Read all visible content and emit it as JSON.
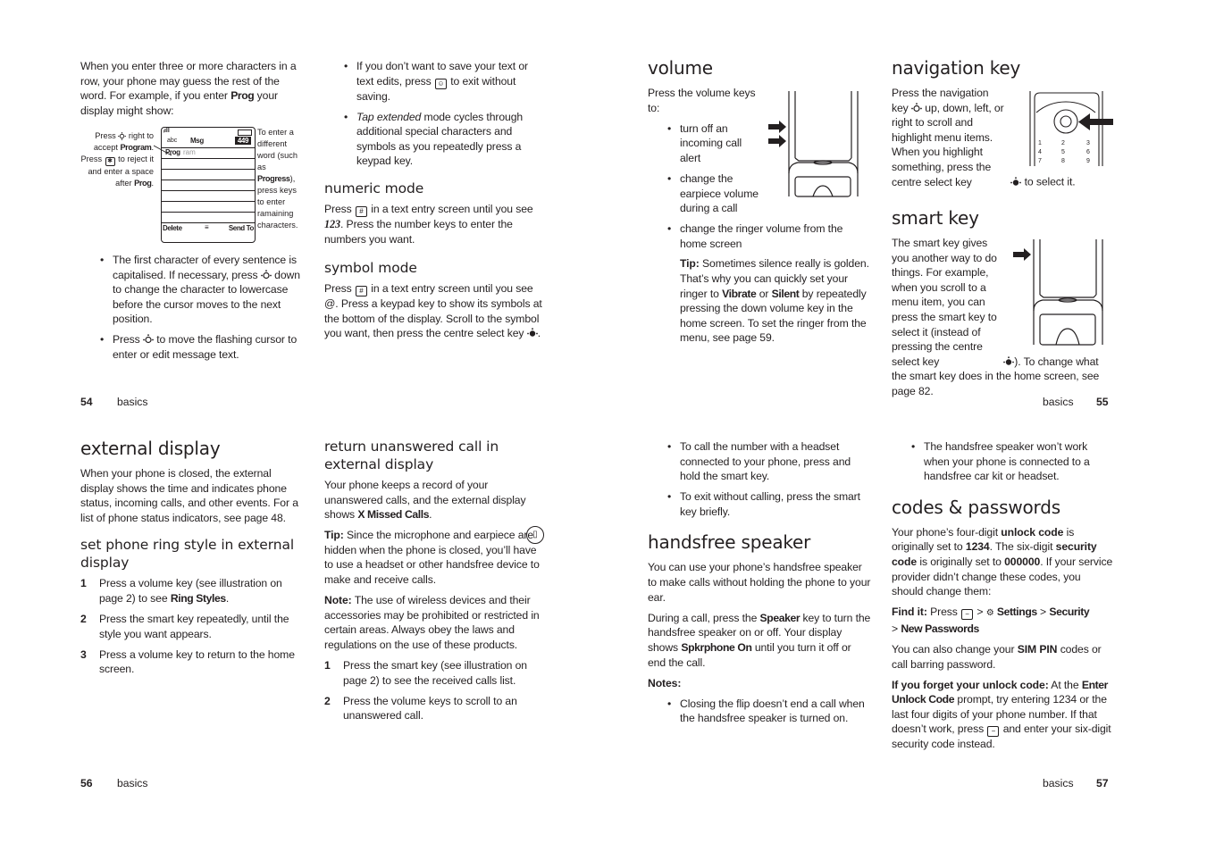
{
  "page54": {
    "intro": "When you enter three or more characters in a row, your phone may guess the rest of the word. For example, if you enter",
    "intro_bold": "Prog",
    "intro_end": "your display might show:",
    "figure": {
      "left_note_1": "Press",
      "left_note_2": "right to accept",
      "left_note_bold": "Program",
      "left_note_3": "Press",
      "left_note_4": "to reject it and enter a space after",
      "left_note_bold2": "Prog",
      "right_note_1": "To enter a different word (such as",
      "right_note_bold": "Progress",
      "right_note_2": "), press keys to enter ramaining characters.",
      "screen": {
        "mode": "abc",
        "title": "Msg",
        "counter": "449",
        "typed": "Prog",
        "suggestion": "ram",
        "left_softkey": "Delete",
        "right_softkey": "Send To"
      }
    },
    "bullets": [
      {
        "pre": "The first character of every sentence is capitalised. If necessary, press",
        "post": "down to change the character to lowercase before the cursor moves to the next position."
      },
      {
        "pre": "Press",
        "post": "to move the flashing cursor to enter or edit message text."
      }
    ],
    "col2_bullets": [
      {
        "pre": "If you don’t want to save your text or text edits, press",
        "post": "to exit without saving."
      },
      {
        "italic": "Tap extended",
        "post": "mode cycles through additional special characters and symbols as you repeatedly press a keypad key."
      }
    ],
    "numeric": {
      "heading": "numeric mode",
      "pre": "Press",
      "mid": "in a text entry screen until you see",
      "bold": "123",
      "post": ". Press the number keys to enter the numbers you want."
    },
    "symbol": {
      "heading": "symbol mode",
      "pre": "Press",
      "mid": "in a text entry screen until you see @. Press a keypad key to show its symbols at the bottom of the display. Scroll to the symbol you want, then press the centre select key",
      "post": "."
    },
    "footer": {
      "number": "54",
      "section": "basics"
    }
  },
  "page55": {
    "volume": {
      "heading": "volume",
      "intro": "Press the volume keys to:",
      "bullets": [
        "turn off an incoming call alert",
        "change the earpiece volume during a call",
        "change the ringer volume from the home screen"
      ],
      "tip_label": "Tip:",
      "tip_1": "Sometimes silence really is golden. That’s why you can quickly set your ringer to",
      "tip_bold1": "Vibrate",
      "tip_or": "or",
      "tip_bold2": "Silent",
      "tip_2": "by repeatedly pressing the down volume key in the home screen. To set the ringer from the menu, see page 59."
    },
    "navigation": {
      "heading": "navigation key",
      "pre": "Press the navigation key",
      "mid": "up, down, left, or right to scroll and highlight menu items. When you highlight something, press the centre select key",
      "post": "to select it.",
      "keypad": [
        "1",
        "2",
        "3",
        "4",
        "5",
        "6",
        "7",
        "8",
        "9"
      ]
    },
    "smart": {
      "heading": "smart key",
      "pre": "The smart key gives you another way to do things. For example, when you scroll to a menu item, you can press the smart key to select it (instead of pressing the centre select key",
      "post": "). To change what the smart key does in the home screen, see page 82."
    },
    "footer": {
      "number": "55",
      "section": "basics"
    }
  },
  "page56": {
    "external": {
      "heading": "external display",
      "body": "When your phone is closed, the external display shows the time and indicates phone status, incoming calls, and other events. For a list of phone status indicators, see page 48."
    },
    "ring": {
      "heading": "set phone ring style in external display",
      "steps": [
        {
          "n": "1",
          "pre": "Press a volume key (see illustration on page 2) to see",
          "bold": "Ring Styles",
          "post": "."
        },
        {
          "n": "2",
          "pre": "Press the smart key repeatedly, until the style you want appears.",
          "bold": "",
          "post": ""
        },
        {
          "n": "3",
          "pre": "Press a volume key to return to the home screen.",
          "bold": "",
          "post": ""
        }
      ]
    },
    "return": {
      "heading": "return unanswered call in external display",
      "body_pre": "Your phone keeps a record of your unanswered calls, and the external display shows",
      "body_bold": "X Missed Calls",
      "body_post": ".",
      "tip_label": "Tip:",
      "tip": "Since the microphone and earpiece are hidden when the phone is closed, you’ll have to use a headset or other handsfree device to make and receive calls.",
      "note_label": "Note:",
      "note": "The use of wireless devices and their accessories may be prohibited or restricted in certain areas. Always obey the laws and regulations on the use of these products.",
      "steps": [
        {
          "n": "1",
          "text": "Press the smart key (see illustration on page 2) to see the received calls list."
        },
        {
          "n": "2",
          "text": "Press the volume keys to scroll to an unanswered call."
        }
      ]
    },
    "footer": {
      "number": "56",
      "section": "basics"
    }
  },
  "page57": {
    "bullets_top": [
      "To call the number with a headset connected to your phone, press and hold the smart key.",
      "To exit without calling, press the smart key briefly."
    ],
    "handsfree": {
      "heading": "handsfree speaker",
      "p1": "You can use your phone’s handsfree speaker to make calls without holding the phone to your ear.",
      "p2_pre": "During a call, press the",
      "p2_bold": "Speaker",
      "p2_mid": "key to turn the handsfree speaker on or off. Your display shows",
      "p2_bold2": "Spkrphone On",
      "p2_post": "until you turn it off or end the call.",
      "notes_label": "Notes:",
      "notes": [
        "Closing the flip doesn’t end a call when the handsfree speaker is turned on.",
        "The handsfree speaker won’t work when your phone is connected to a handsfree car kit or headset."
      ]
    },
    "codes": {
      "heading": "codes & passwords",
      "p1": [
        "Your phone’s four-digit ",
        "unlock code",
        " is originally set to ",
        "1234",
        ". The six-digit ",
        "security code",
        " is originally set to ",
        "000000",
        ". If your service provider didn’t change these codes, you should change them:"
      ],
      "find_label": "Find it:",
      "find_press": "Press",
      "find_path": [
        "Settings",
        "Security",
        "New Passwords"
      ],
      "sep": ">",
      "p2_pre": "You can also change your",
      "p2_bold": "SIM PIN",
      "p2_post": "codes or call barring password.",
      "forget_label": "If you forget your unlock code:",
      "forget_1": "At the",
      "forget_bold": "Enter Unlock Code",
      "forget_2": "prompt, try entering 1234 or the last four digits of your phone number. If that doesn’t work, press",
      "forget_3": "and enter your six-digit security code instead."
    },
    "footer": {
      "number": "57",
      "section": "basics"
    }
  }
}
